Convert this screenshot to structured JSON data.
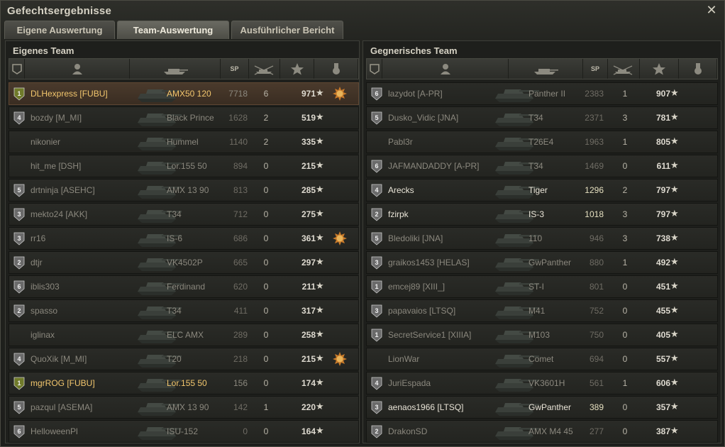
{
  "window": {
    "title": "Gefechtsergebnisse",
    "close_icon": "close-icon"
  },
  "tabs": [
    {
      "label": "Eigene Auswertung",
      "active": false
    },
    {
      "label": "Team-Auswertung",
      "active": true
    },
    {
      "label": "Ausführlicher Bericht",
      "active": false
    }
  ],
  "columns": {
    "exp_label": "SP"
  },
  "teams": [
    {
      "title": "Eigenes Team",
      "players": [
        {
          "badge": "1",
          "badge_color": "#6f7a2a",
          "name": "DLHexpress [FUBU]",
          "tank": "AMX50 120",
          "exp": "7718",
          "kills": "6",
          "points": "971",
          "medal": true,
          "style": "self",
          "highlight": true
        },
        {
          "badge": "4",
          "name": "bozdy [M_MI]",
          "tank": "Black Prince",
          "exp": "1628",
          "kills": "2",
          "points": "519",
          "medal": false
        },
        {
          "badge": "",
          "name": "nikonier",
          "tank": "Hummel",
          "exp": "1140",
          "kills": "2",
          "points": "335",
          "medal": false
        },
        {
          "badge": "",
          "name": "hit_me [DSH]",
          "tank": "Lor.155 50",
          "exp": "894",
          "kills": "0",
          "points": "215",
          "medal": false
        },
        {
          "badge": "5",
          "name": "drtninja [ASEHC]",
          "tank": "AMX 13 90",
          "exp": "813",
          "kills": "0",
          "points": "285",
          "medal": false
        },
        {
          "badge": "3",
          "name": "mekto24 [AKK]",
          "tank": "T34",
          "exp": "712",
          "kills": "0",
          "points": "275",
          "medal": false
        },
        {
          "badge": "3",
          "name": "rr16",
          "tank": "IS-6",
          "exp": "686",
          "kills": "0",
          "points": "361",
          "medal": true
        },
        {
          "badge": "2",
          "name": "dtjr",
          "tank": "VK4502P",
          "exp": "665",
          "kills": "0",
          "points": "297",
          "medal": false
        },
        {
          "badge": "6",
          "name": "iblis303",
          "tank": "Ferdinand",
          "exp": "620",
          "kills": "0",
          "points": "211",
          "medal": false
        },
        {
          "badge": "2",
          "name": "spasso",
          "tank": "T34",
          "exp": "411",
          "kills": "0",
          "points": "317",
          "medal": false
        },
        {
          "badge": "",
          "name": "iglinax",
          "tank": "ELC AMX",
          "exp": "289",
          "kills": "0",
          "points": "258",
          "medal": false
        },
        {
          "badge": "4",
          "name": "QuoXik [M_MI]",
          "tank": "T20",
          "exp": "218",
          "kills": "0",
          "points": "215",
          "medal": true
        },
        {
          "badge": "1",
          "badge_color": "#6f7a2a",
          "name": "mgrROG [FUBU]",
          "tank": "Lor.155 50",
          "exp": "156",
          "kills": "0",
          "points": "174",
          "medal": false,
          "style": "self"
        },
        {
          "badge": "5",
          "name": "pazqul [ASEMA]",
          "tank": "AMX 13 90",
          "exp": "142",
          "kills": "1",
          "points": "220",
          "medal": false
        },
        {
          "badge": "6",
          "name": "HelloweenPl",
          "tank": "ISU-152",
          "exp": "0",
          "kills": "0",
          "points": "164",
          "medal": false
        }
      ]
    },
    {
      "title": "Gegnerisches Team",
      "players": [
        {
          "badge": "6",
          "name": "lazydot [A-PR]",
          "tank": "Panther II",
          "exp": "2383",
          "kills": "1",
          "points": "907",
          "medal": false
        },
        {
          "badge": "5",
          "name": "Dusko_Vidic [JNA]",
          "tank": "T34",
          "exp": "2371",
          "kills": "3",
          "points": "781",
          "medal": false
        },
        {
          "badge": "",
          "name": "Pabl3r",
          "tank": "T26E4",
          "exp": "1963",
          "kills": "1",
          "points": "805",
          "medal": false
        },
        {
          "badge": "6",
          "name": "JAFMANDADDY [A-PR]",
          "tank": "T34",
          "exp": "1469",
          "kills": "0",
          "points": "611",
          "medal": false
        },
        {
          "badge": "4",
          "name": "Arecks",
          "tank": "Tiger",
          "exp": "1296",
          "kills": "2",
          "points": "797",
          "medal": false,
          "style": "bright"
        },
        {
          "badge": "2",
          "name": "fzirpk",
          "tank": "IS-3",
          "exp": "1018",
          "kills": "3",
          "points": "797",
          "medal": false,
          "style": "bright"
        },
        {
          "badge": "5",
          "name": "Bledoliki [JNA]",
          "tank": "110",
          "exp": "946",
          "kills": "3",
          "points": "738",
          "medal": false
        },
        {
          "badge": "3",
          "name": "graikos1453 [HELAS]",
          "tank": "GwPanther",
          "exp": "880",
          "kills": "1",
          "points": "492",
          "medal": false
        },
        {
          "badge": "1",
          "name": "emcej89 [XIII_]",
          "tank": "ST-I",
          "exp": "801",
          "kills": "0",
          "points": "451",
          "medal": false
        },
        {
          "badge": "3",
          "name": "papavaios [LTSQ]",
          "tank": "M41",
          "exp": "752",
          "kills": "0",
          "points": "455",
          "medal": false
        },
        {
          "badge": "1",
          "name": "SecretService1 [XIIIA]",
          "tank": "M103",
          "exp": "750",
          "kills": "0",
          "points": "405",
          "medal": false
        },
        {
          "badge": "",
          "name": "LionWar",
          "tank": "Comet",
          "exp": "694",
          "kills": "0",
          "points": "557",
          "medal": false
        },
        {
          "badge": "4",
          "name": "JuriEspada",
          "tank": "VK3601H",
          "exp": "561",
          "kills": "1",
          "points": "606",
          "medal": false
        },
        {
          "badge": "3",
          "name": "aenaos1966 [LTSQ]",
          "tank": "GwPanther",
          "exp": "389",
          "kills": "0",
          "points": "357",
          "medal": false,
          "style": "bright"
        },
        {
          "badge": "2",
          "name": "DrakonSD",
          "tank": "AMX M4 45",
          "exp": "277",
          "kills": "0",
          "points": "387",
          "medal": false
        }
      ]
    }
  ]
}
